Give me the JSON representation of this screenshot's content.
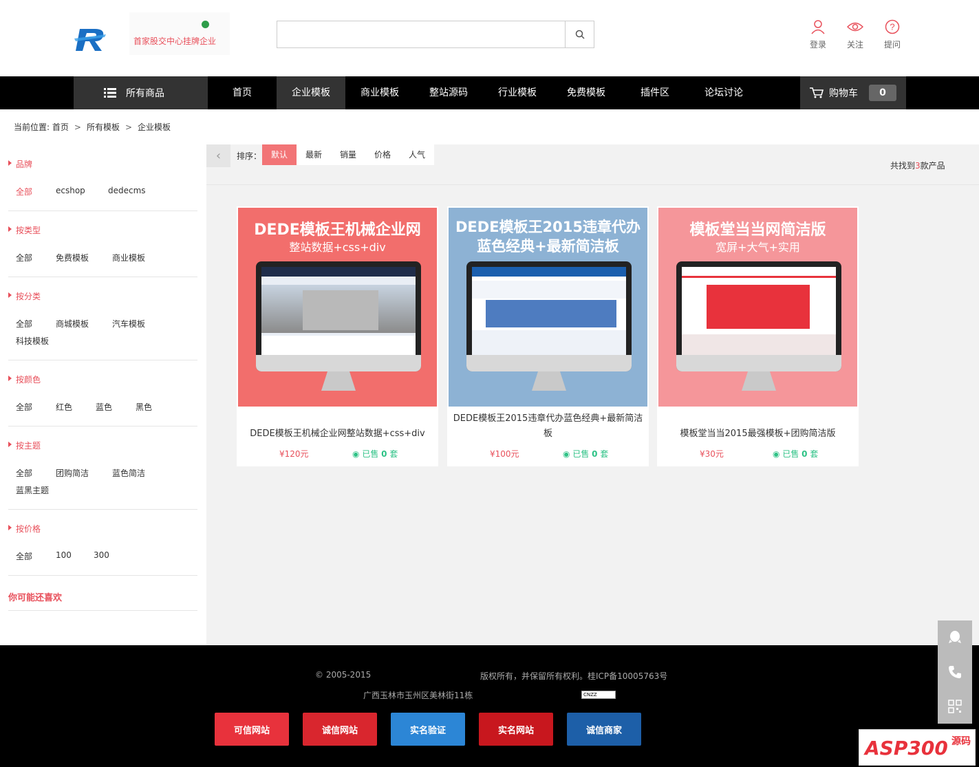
{
  "header": {
    "slogan": "首家股交中心挂牌企业",
    "search": {
      "placeholder": "",
      "value": ""
    },
    "tools": [
      {
        "label": "登录",
        "icon": "user-icon"
      },
      {
        "label": "关注",
        "icon": "eye-icon"
      },
      {
        "label": "提问",
        "icon": "question-icon"
      }
    ]
  },
  "nav": {
    "all_label": "所有商品",
    "items": [
      "首页",
      "企业模板",
      "商业模板",
      "整站源码",
      "行业模板",
      "免费模板",
      "插件区",
      "论坛讨论"
    ],
    "active": "企业模板",
    "cart_label": "购物车",
    "cart_count": "0"
  },
  "breadcrumb": {
    "prefix": "当前位置:",
    "items": [
      "首页",
      "所有模板",
      "企业模板"
    ],
    "sep": ">"
  },
  "filters": [
    {
      "title": "品牌",
      "options": [
        "全部",
        "ecshop",
        "dedecms"
      ]
    },
    {
      "title": "按类型",
      "options": [
        "全部",
        "免费模板",
        "商业模板"
      ]
    },
    {
      "title": "按分类",
      "options": [
        "全部",
        "商城模板",
        "汽车模板",
        "科技模板"
      ]
    },
    {
      "title": "按颜色",
      "options": [
        "全部",
        "红色",
        "蓝色",
        "黑色"
      ]
    },
    {
      "title": "按主题",
      "options": [
        "全部",
        "团购简洁",
        "蓝色简洁",
        "蓝黑主题"
      ]
    },
    {
      "title": "按价格",
      "options": [
        "全部",
        "100",
        "300"
      ]
    }
  ],
  "like_title": "你可能还喜欢",
  "sort": {
    "label": "排序：",
    "options": [
      "默认",
      "最新",
      "销量",
      "价格",
      "人气"
    ],
    "active": "默认"
  },
  "found": {
    "prefix": "共找到",
    "count": "3",
    "suffix": "款产品"
  },
  "products": [
    {
      "thumb_title": "DEDE模板王机械企业网",
      "thumb_sub": "整站数据+css+div",
      "thumb_color": "#f26e6c",
      "name": "DEDE模板王机械企业网整站数据+css+div",
      "price": "¥120元",
      "sold_prefix": "已售",
      "sold_count": "0",
      "sold_unit": "套"
    },
    {
      "thumb_title": "DEDE模板王2015违章代办",
      "thumb_sub": "蓝色经典+最新简洁板",
      "thumb_color": "#8db2d4",
      "name": "DEDE模板王2015违章代办蓝色经典+最新简洁板",
      "price": "¥100元",
      "sold_prefix": "已售",
      "sold_count": "0",
      "sold_unit": "套"
    },
    {
      "thumb_title": "模板堂当当网简洁版",
      "thumb_sub": "宽屏+大气+实用",
      "thumb_color": "#f5969a",
      "name": "模板堂当当2015最强模板+团购简洁版",
      "price": "¥30元",
      "sold_prefix": "已售",
      "sold_count": "0",
      "sold_unit": "套"
    }
  ],
  "footer": {
    "copyright": "© 2005-2015",
    "rights": "版权所有，并保留所有权利。桂ICP备10005763号",
    "address": "广西玉林市玉州区美林街11栋",
    "cnzz": "CNZZ",
    "badges": [
      {
        "label": "可信网站",
        "color": "#e8323c"
      },
      {
        "label": "诚信网站",
        "color": "#d9262e"
      },
      {
        "label": "实名验证",
        "color": "#2c86d6"
      },
      {
        "label": "实名网站",
        "color": "#c8171e"
      },
      {
        "label": "诚信商家",
        "color": "#1d5fa8"
      }
    ]
  },
  "watermark": {
    "text": "ASP300",
    "side": "源码"
  },
  "colors": {
    "accent": "#e8505b",
    "sold": "#2ec286",
    "nav_bg": "#000000"
  }
}
